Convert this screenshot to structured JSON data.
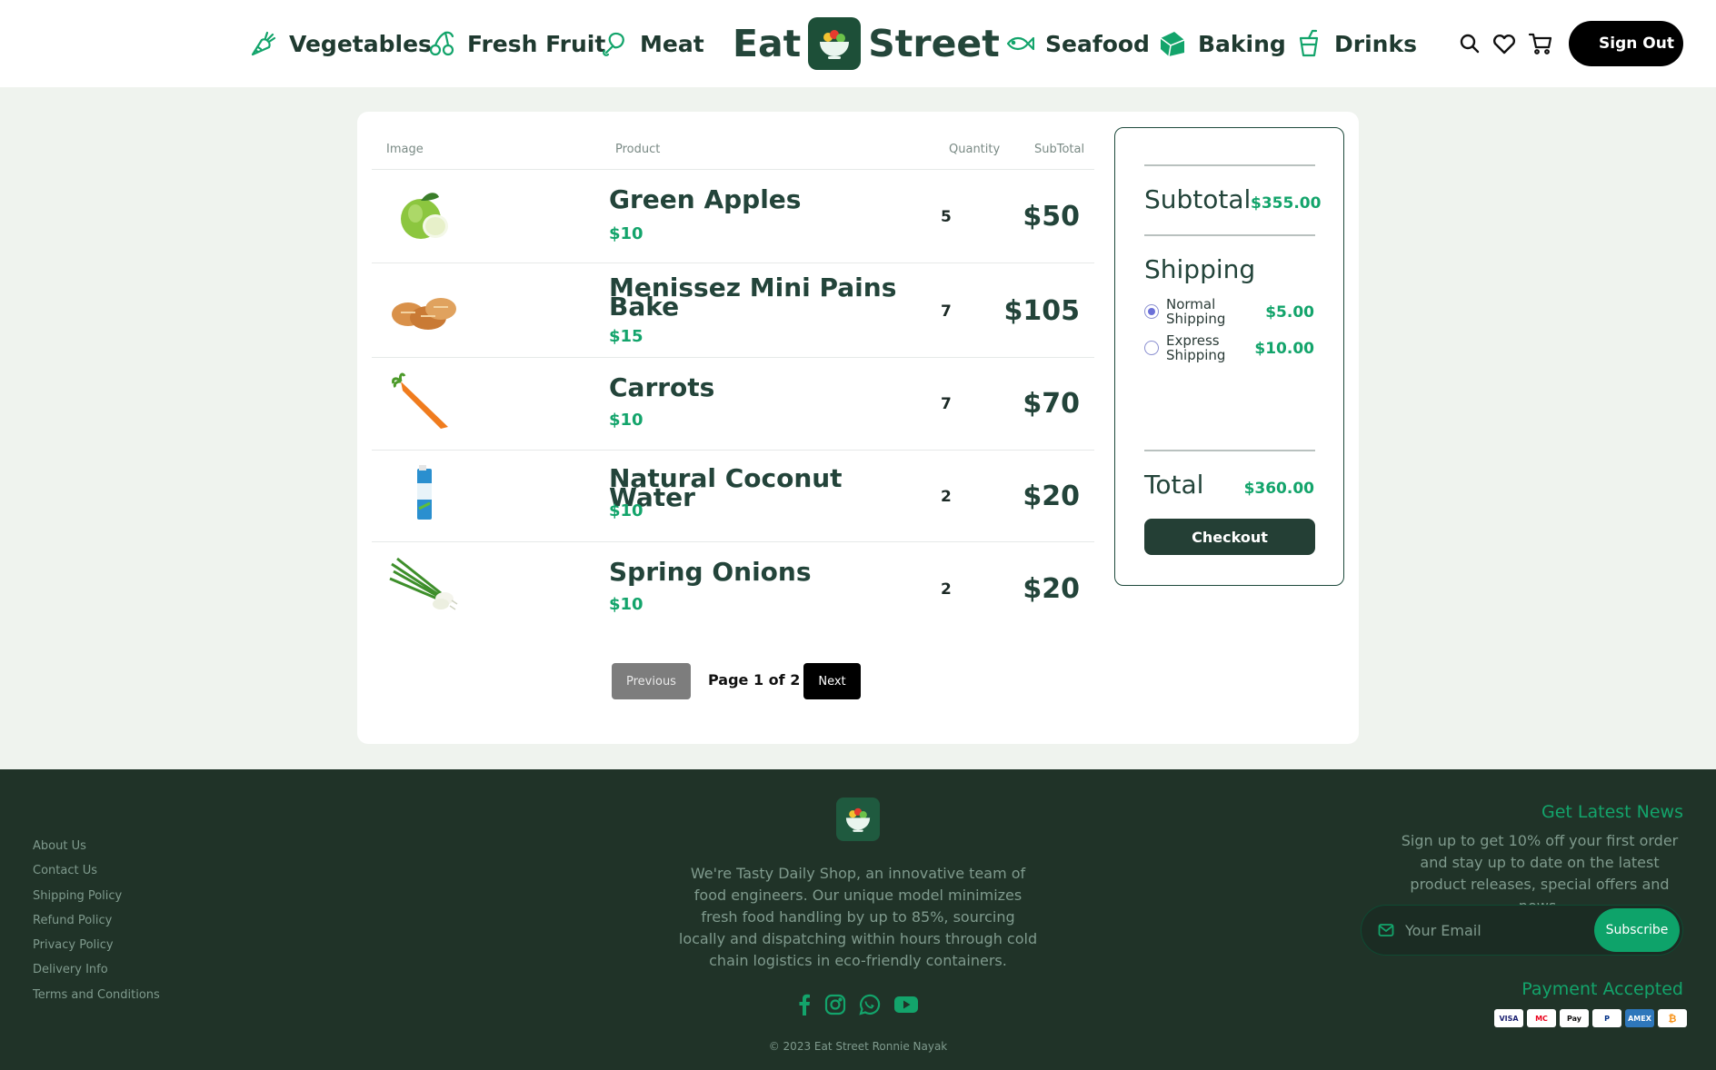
{
  "header": {
    "nav_left": [
      {
        "label": "Vegetables",
        "icon": "carrot-icon"
      },
      {
        "label": "Fresh Fruit",
        "icon": "cherries-icon"
      },
      {
        "label": "Meat",
        "icon": "drumstick-icon"
      }
    ],
    "logo": {
      "left": "Eat",
      "right": "Street",
      "icon": "bowl-icon"
    },
    "nav_right": [
      {
        "label": "Seafood",
        "icon": "fish-icon"
      },
      {
        "label": "Baking",
        "icon": "bread-icon"
      },
      {
        "label": "Drinks",
        "icon": "cup-icon"
      }
    ],
    "icons": [
      "search-icon",
      "heart-icon",
      "cart-icon"
    ],
    "sign_out": "Sign Out"
  },
  "cart": {
    "columns": {
      "image": "Image",
      "product": "Product",
      "quantity": "Quantity",
      "subtotal": "SubTotal"
    },
    "items": [
      {
        "name": "Green Apples",
        "price": "$10",
        "qty": "5",
        "subtotal": "$50",
        "image": "green-apples-image"
      },
      {
        "name": "Menissez Mini Pains Bake",
        "price": "$15",
        "qty": "7",
        "subtotal": "$105",
        "image": "bread-rolls-image"
      },
      {
        "name": "Carrots",
        "price": "$10",
        "qty": "7",
        "subtotal": "$70",
        "image": "carrot-image"
      },
      {
        "name": "Natural Coconut Water",
        "price": "$10",
        "qty": "2",
        "subtotal": "$20",
        "image": "coconut-water-image"
      },
      {
        "name": "Spring Onions",
        "price": "$10",
        "qty": "2",
        "subtotal": "$20",
        "image": "spring-onions-image"
      }
    ],
    "pagination": {
      "previous": "Previous",
      "page_label": "Page 1 of 2",
      "next": "Next"
    }
  },
  "summary": {
    "subtotal_label": "Subtotal",
    "subtotal_value": "$355.00",
    "shipping_label": "Shipping",
    "options": [
      {
        "label": "Normal Shipping",
        "price": "$5.00",
        "selected": true
      },
      {
        "label": "Express Shipping",
        "price": "$10.00",
        "selected": false
      }
    ],
    "total_label": "Total",
    "total_value": "$360.00",
    "checkout": "Checkout"
  },
  "footer": {
    "links": [
      "About Us",
      "Contact Us",
      "Shipping Policy",
      "Refund Policy",
      "Privacy Policy",
      "Delivery Info",
      "Terms and Conditions"
    ],
    "about": "We're Tasty Daily Shop, an innovative team of food engineers. Our unique model minimizes fresh food handling by up to 85%, sourcing locally and dispatching within hours through cold chain logistics in eco-friendly containers.",
    "social": [
      "facebook-icon",
      "instagram-icon",
      "whatsapp-icon",
      "youtube-icon"
    ],
    "copyright": "© 2023 Eat Street Ronnie Nayak",
    "news_title": "Get Latest News",
    "news_text": "Sign up to get 10% off your first order and stay up to date on the latest product releases, special offers and news.",
    "email_placeholder": "Your Email",
    "subscribe": "Subscribe",
    "payment_title": "Payment Accepted",
    "payments": [
      "VISA",
      "MC",
      "Pay",
      "P",
      "AMEX",
      "₿"
    ]
  },
  "colors": {
    "brand_dark": "#23443a",
    "accent_green": "#13a46b",
    "footer_bg": "#203328",
    "page_bg": "#eff3ee"
  }
}
